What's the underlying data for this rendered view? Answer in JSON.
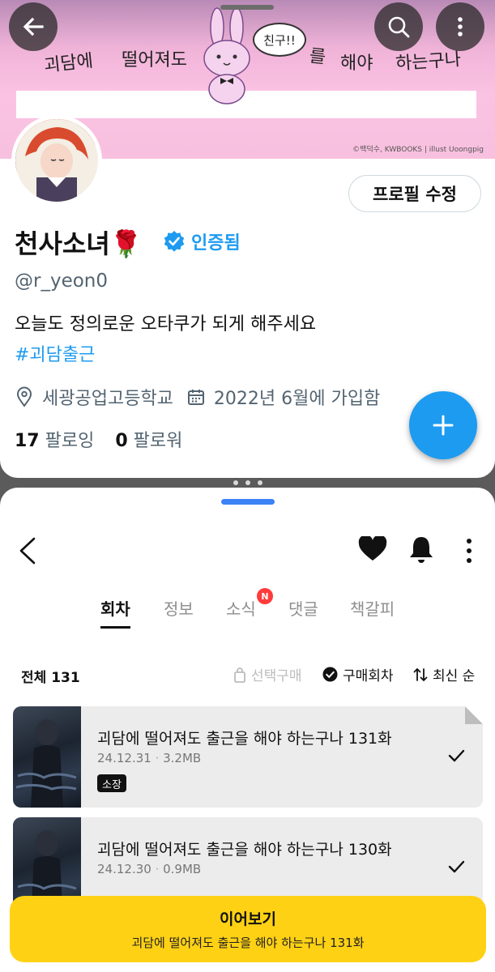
{
  "profile_app": {
    "banner": {
      "words": [
        "괴담에",
        "떨어져도",
        "를",
        "해야",
        "하는구나"
      ],
      "bubble_text": "친구!!",
      "credit": "©백덕수, KWBOOKS | illust Uoongpig"
    },
    "edit_profile_label": "프로필 수정",
    "name": "천사소녀🌹",
    "verified_label": "인증됨",
    "handle": "@r_yeon0",
    "bio": "오늘도 정의로운 오타쿠가 되게 해주세요",
    "hashtag": "#괴담출근",
    "location": "세광공업고등학교",
    "joined": "2022년 6월에 가입함",
    "following_count": "17",
    "following_label": "팔로잉",
    "followers_count": "0",
    "followers_label": "팔로워",
    "accent_color": "#1d9bf0"
  },
  "series_app": {
    "tabs": [
      {
        "label": "회차",
        "active": true
      },
      {
        "label": "정보",
        "active": false
      },
      {
        "label": "소식",
        "active": false,
        "badge": "N"
      },
      {
        "label": "댓글",
        "active": false
      },
      {
        "label": "책갈피",
        "active": false
      }
    ],
    "total_label": "전체 131",
    "select_purchase_label": "선택구매",
    "purchased_label": "구매회차",
    "sort_label": "최신 순",
    "episodes": [
      {
        "title": "괴담에 떨어져도 출근을 해야 하는구나 131화",
        "date": "24.12.31",
        "size": "3.2MB",
        "badge": "소장"
      },
      {
        "title": "괴담에 떨어져도 출근을 해야 하는구나 130화",
        "date": "24.12.30",
        "size": "0.9MB",
        "badge": ""
      }
    ],
    "resume": {
      "label": "이어보기",
      "subtitle": "괴담에 떨어져도 출근을 해야 하는구나 131화"
    },
    "resume_color": "#ffd114"
  }
}
